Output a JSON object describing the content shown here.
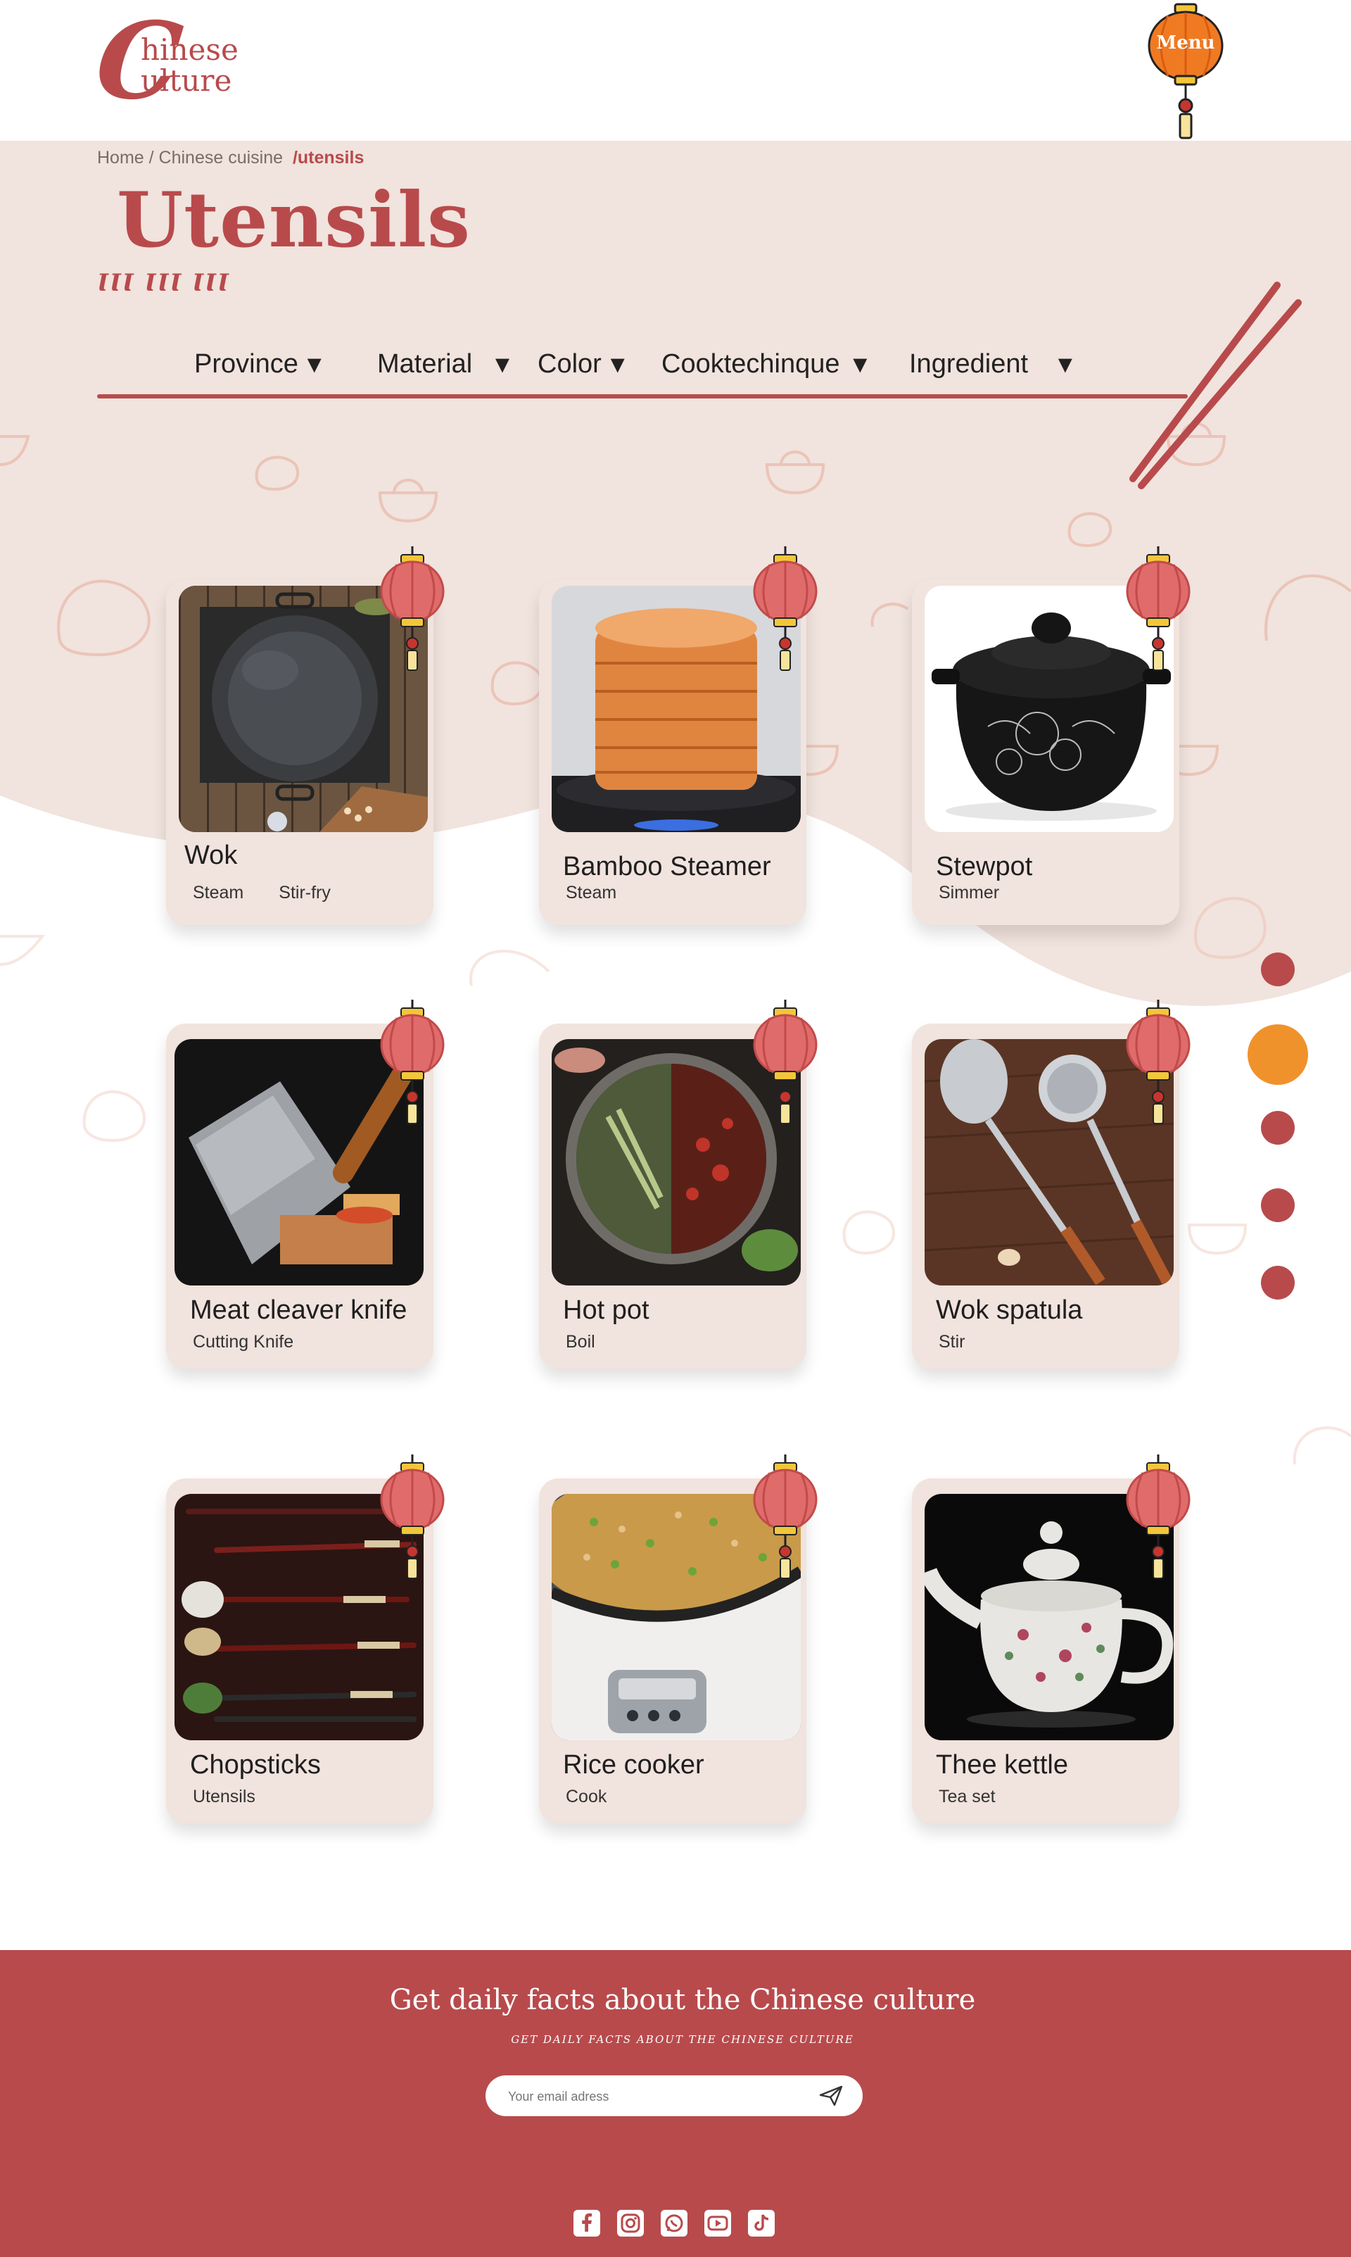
{
  "header": {
    "logo_initial": "C",
    "logo_line1": "hinese",
    "logo_line2": "ulture",
    "menu_label": "Menu"
  },
  "breadcrumb": {
    "home": "Home",
    "section": "Chinese cuisine",
    "current": "/utensils"
  },
  "page": {
    "title": "Utensils",
    "subtitle": "ꙆꙆꙆ ꙆꙆꙆ ꙆꙆꙆ"
  },
  "filters": [
    {
      "label": "Province"
    },
    {
      "label": "Material"
    },
    {
      "label": "Color"
    },
    {
      "label": "Cooktechinque"
    },
    {
      "label": "Ingredient"
    }
  ],
  "filter_arrow": "▼",
  "pagination": {
    "count": 5,
    "active": 2
  },
  "cards": [
    {
      "name": "Wok",
      "tags": [
        "Steam",
        "Stir-fry"
      ],
      "image": "wok-photo"
    },
    {
      "name": "Bamboo Steamer",
      "tags": [
        "Steam"
      ],
      "image": "bamboo-steamer-photo"
    },
    {
      "name": "Stewpot",
      "tags": [
        "Simmer"
      ],
      "image": "stewpot-photo"
    },
    {
      "name": "Meat cleaver knife",
      "tags": [
        "Cutting Knife"
      ],
      "image": "cleaver-photo"
    },
    {
      "name": "Hot pot",
      "tags": [
        "Boil"
      ],
      "image": "hot-pot-photo"
    },
    {
      "name": "Wok spatula",
      "tags": [
        "Stir"
      ],
      "image": "wok-spatula-photo"
    },
    {
      "name": "Chopsticks",
      "tags": [
        "Utensils"
      ],
      "image": "chopsticks-photo"
    },
    {
      "name": "Rice cooker",
      "tags": [
        "Cook"
      ],
      "image": "rice-cooker-photo"
    },
    {
      "name": "Thee kettle",
      "tags": [
        "Tea set"
      ],
      "image": "teapot-photo"
    }
  ],
  "footer": {
    "newsletter_title": "Get daily facts about the Chinese culture",
    "newsletter_subtitle": "GET DAILY FACTS ABOUT THE CHINESE CULTURE",
    "email_placeholder": "Your email adress",
    "social_icons": [
      "facebook-icon",
      "instagram-icon",
      "whatsapp-icon",
      "youtube-icon",
      "tiktok-icon"
    ]
  },
  "colors": {
    "accent": "#b84a4c",
    "hero_bg": "#f1e3dd",
    "active_dot": "#f0922c",
    "lantern_red": "#e06b6b",
    "lantern_gold": "#f3c63a"
  }
}
